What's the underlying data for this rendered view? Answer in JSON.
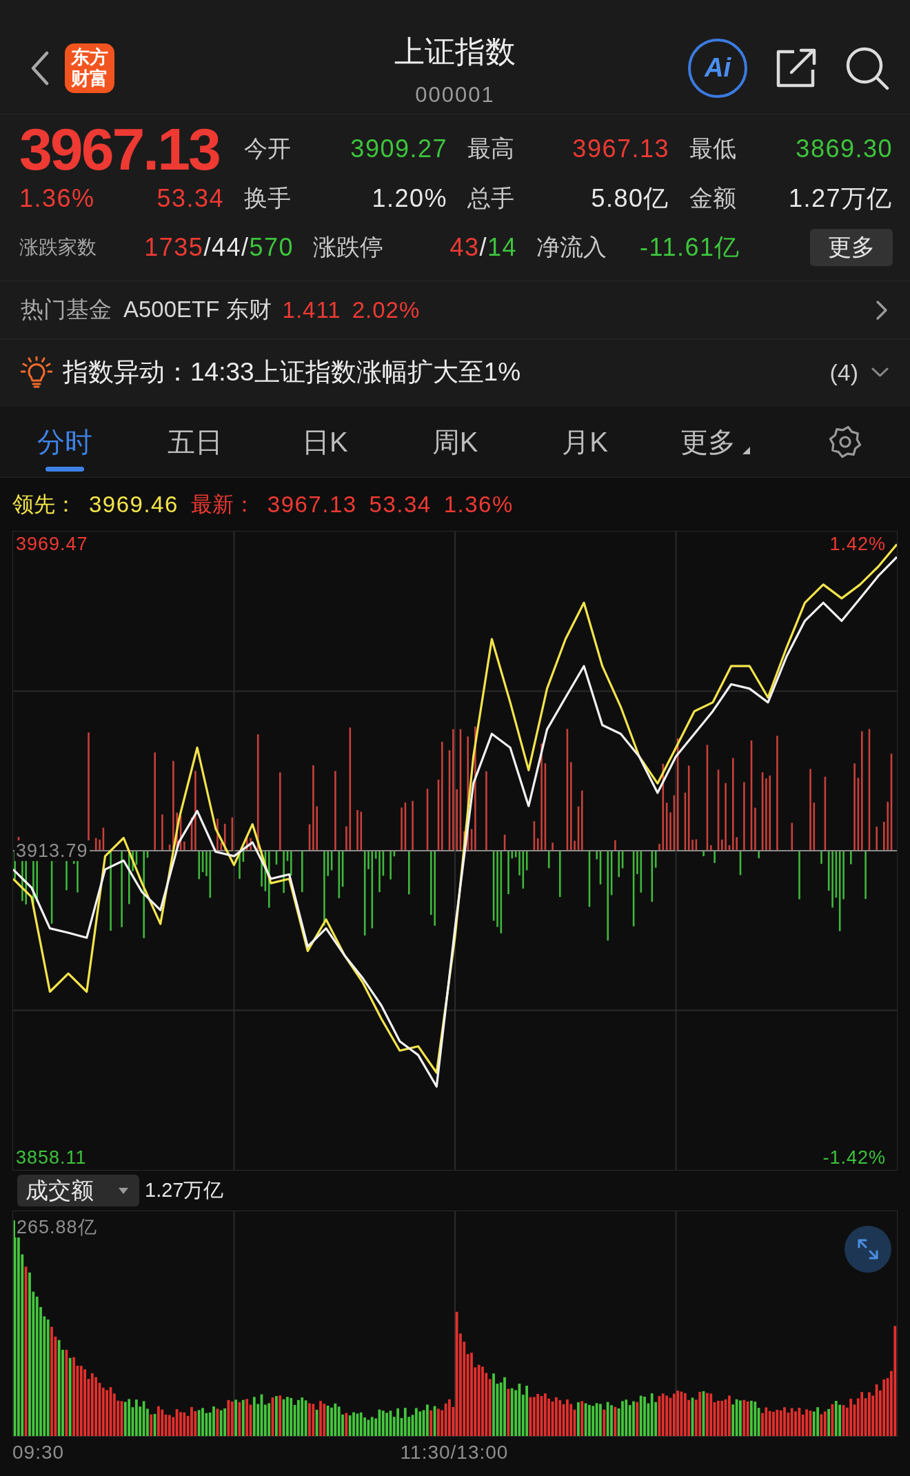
{
  "header": {
    "logo": [
      "东方",
      "财富"
    ],
    "title": "上证指数",
    "code": "000001",
    "ai_label": "Ai"
  },
  "quote": {
    "price": {
      "text": "3967.13",
      "color": "#ee3a33"
    },
    "change_percent": {
      "text": "1.36%",
      "color": "#ee3a33"
    },
    "change": {
      "text": "53.34",
      "color": "#ee3a33"
    },
    "stats": [
      {
        "label": "今开",
        "value": "3909.27",
        "color": "#3dc43c"
      },
      {
        "label": "最高",
        "value": "3967.13",
        "color": "#ee3a33"
      },
      {
        "label": "最低",
        "value": "3869.30",
        "color": "#3dc43c"
      },
      {
        "label": "换手",
        "value": "1.20%",
        "color": "#e8e8e8"
      },
      {
        "label": "总手",
        "value": "5.80亿",
        "color": "#e8e8e8"
      },
      {
        "label": "金额",
        "value": "1.27万亿",
        "color": "#e8e8e8"
      }
    ],
    "market": [
      {
        "label": "涨跌家数",
        "parts": [
          {
            "text": "1735",
            "color": "#ee3a33"
          },
          {
            "text": "/44/",
            "color": "#e8e8e8"
          },
          {
            "text": "570",
            "color": "#3dc43c"
          }
        ]
      },
      {
        "label": "涨跌停",
        "parts": [
          {
            "text": "43",
            "color": "#ee3a33"
          },
          {
            "text": "/",
            "color": "#e8e8e8"
          },
          {
            "text": "14",
            "color": "#3dc43c"
          }
        ]
      },
      {
        "label": "净流入",
        "parts": [
          {
            "text": "-11.61亿",
            "color": "#3dc43c"
          }
        ]
      }
    ],
    "more_button": "更多"
  },
  "hot_fund": {
    "label": "热门基金",
    "name": "A500ETF 东财",
    "price": "1.411",
    "change": "2.02%",
    "color": "#ee3a33"
  },
  "alert": {
    "text": "指数异动：14:33上证指数涨幅扩大至1%",
    "count": "(4)"
  },
  "tabs": [
    {
      "label": "分时",
      "kind": "tab",
      "selected": true
    },
    {
      "label": "五日",
      "kind": "tab",
      "selected": false
    },
    {
      "label": "日K",
      "kind": "tab",
      "selected": false
    },
    {
      "label": "周K",
      "kind": "tab",
      "selected": false
    },
    {
      "label": "月K",
      "kind": "tab",
      "selected": false
    },
    {
      "label": "更多",
      "kind": "menu",
      "selected": false
    }
  ],
  "quote_line": [
    {
      "text": "领先：",
      "color": "#f3e44b"
    },
    {
      "text": "3969.46",
      "color": "#f3e44b"
    },
    {
      "text": "最新：",
      "color": "#ee3a33"
    },
    {
      "text": "3967.13",
      "color": "#ee3a33"
    },
    {
      "text": "53.34",
      "color": "#ee3a33"
    },
    {
      "text": "1.36%",
      "color": "#ee3a33"
    }
  ],
  "intraday": {
    "chart_data": {
      "type": "line",
      "grid": true,
      "categories": [
        null,
        null,
        null,
        null,
        null,
        null,
        null,
        null,
        null,
        null,
        null,
        null,
        null,
        null,
        null,
        null,
        null,
        null,
        null,
        null,
        null,
        null,
        null,
        null,
        null,
        null,
        null,
        null,
        null,
        null,
        null,
        null,
        null,
        null,
        null,
        null,
        null,
        null,
        null,
        null,
        null,
        null,
        null,
        null,
        null,
        null,
        null,
        null,
        null
      ],
      "ylim": [
        3855.86,
        3971.72
      ],
      "yticks": [
        {
          "value": 3858.11,
          "label": "3858.11"
        },
        {
          "value": 3913.79,
          "label": "3913.79"
        },
        {
          "value": 3969.47,
          "label": "3969.47"
        }
      ],
      "series": [
        {
          "color": "#f2f2f2",
          "values": [
            3910.4,
            3907.1,
            3899.7,
            3898.9,
            3898.0,
            3910.4,
            3912.0,
            3906.3,
            3903.0,
            3915.3,
            3921.0,
            3913.6,
            3912.8,
            3915.3,
            3908.7,
            3909.5,
            3896.4,
            3899.7,
            3894.8,
            3890.6,
            3885.7,
            3879.2,
            3876.7,
            3871.0,
            3899.7,
            3926.0,
            3935.0,
            3932.5,
            3921.9,
            3935.8,
            3941.6,
            3947.3,
            3936.6,
            3935.0,
            3930.9,
            3924.3,
            3930.9,
            3935.0,
            3939.1,
            3944.0,
            3943.2,
            3940.7,
            3949.0,
            3955.5,
            3958.8,
            3955.5,
            3959.6,
            3963.7,
            3967.1
          ]
        },
        {
          "color": "#f3e44b",
          "values": [
            3908.7,
            3905.4,
            3888.2,
            3891.5,
            3888.2,
            3912.8,
            3916.1,
            3907.9,
            3900.5,
            3919.4,
            3932.5,
            3917.8,
            3911.2,
            3918.6,
            3907.9,
            3908.7,
            3895.6,
            3901.3,
            3894.8,
            3889.8,
            3883.3,
            3877.5,
            3878.3,
            3873.5,
            3898.1,
            3930.9,
            3952.2,
            3940.7,
            3928.4,
            3943.2,
            3952.2,
            3958.8,
            3947.3,
            3939.9,
            3930.9,
            3926.0,
            3932.5,
            3939.1,
            3940.7,
            3947.3,
            3947.3,
            3941.6,
            3950.6,
            3958.8,
            3962.1,
            3959.6,
            3962.1,
            3965.4,
            3969.4
          ]
        }
      ]
    },
    "right_labels": [
      "1.42%",
      "-1.42%"
    ]
  },
  "volume": {
    "selector": "成交额",
    "total": "1.27万亿",
    "max_label": "265.88亿"
  },
  "time_axis": [
    "09:30",
    "11:30/13:00"
  ]
}
